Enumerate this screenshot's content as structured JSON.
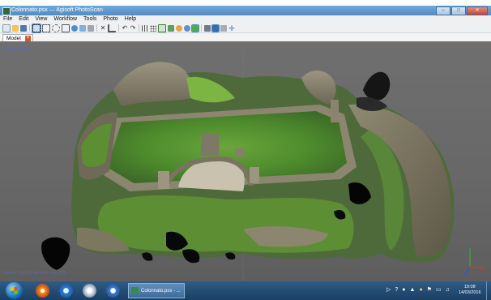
{
  "window": {
    "title": "Colonnato.psx — Agisoft PhotoScan"
  },
  "menu": [
    "File",
    "Edit",
    "View",
    "Workflow",
    "Tools",
    "Photo",
    "Help"
  ],
  "toolbar_icons": [
    "new-icon",
    "open-icon",
    "save-icon",
    "rectangle-select-icon",
    "free-select-icon",
    "circle-select-icon",
    "resize-region-icon",
    "rotate-region-icon",
    "rotate-object-icon",
    "navigation-icon",
    "delete-icon",
    "crop-icon",
    "undo-icon",
    "redo-icon",
    "grid-icon",
    "points-icon",
    "wireframe-icon",
    "solid-icon",
    "shaded-icon",
    "textured-icon",
    "model-icon",
    "cameras-icon",
    "reset-view-icon",
    "orthographic-icon",
    "ruler-icon"
  ],
  "tab": {
    "label": "Model"
  },
  "viewport": {
    "label": "Perspective",
    "stats": "Faces: 90,000 vertices: 45,293"
  },
  "taskbar": {
    "task_label": "Colonnato.psx - ...",
    "time": "19:08",
    "date": "14/03/2016"
  }
}
